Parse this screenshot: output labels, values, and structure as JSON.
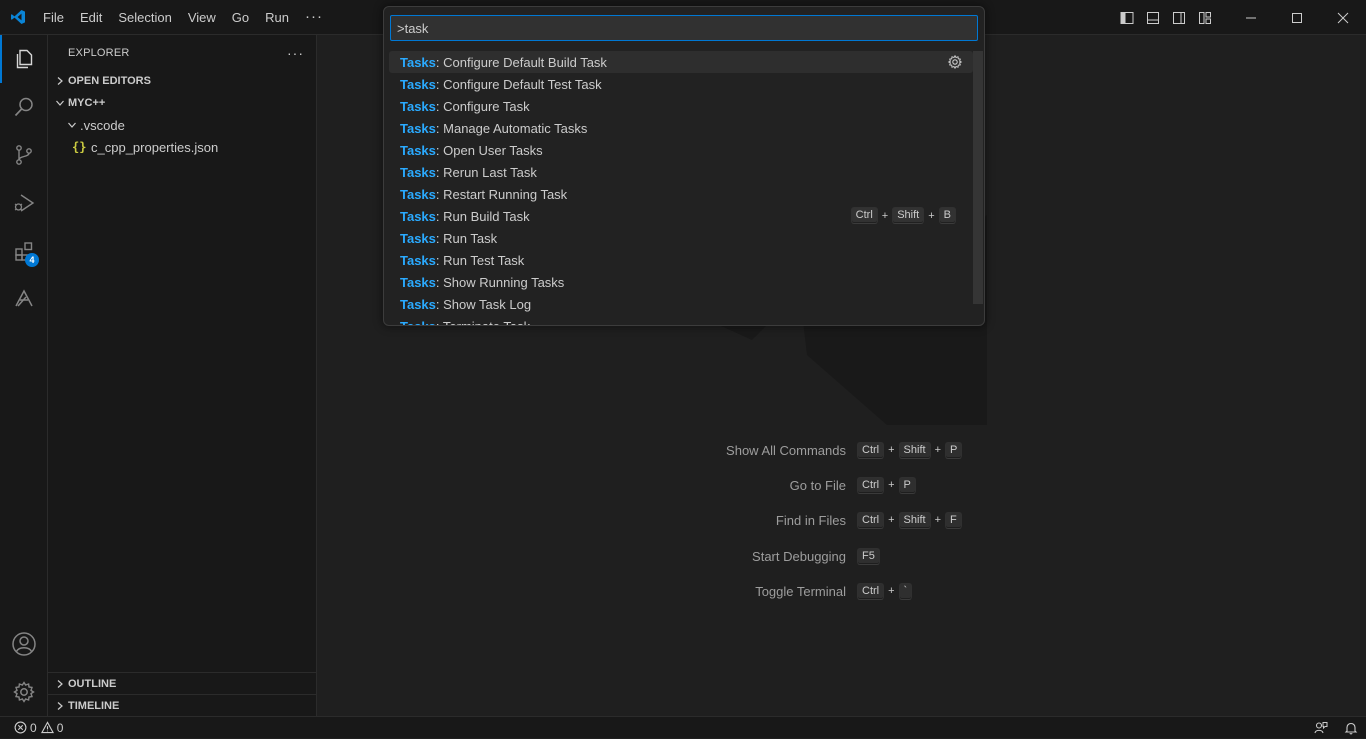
{
  "titlebar": {
    "logo_icon": "vscode-logo-icon",
    "menu": [
      "File",
      "Edit",
      "Selection",
      "View",
      "Go",
      "Run"
    ],
    "more": "···",
    "layout_icons": [
      "toggle-primary-sidebar-icon",
      "toggle-panel-icon",
      "toggle-secondary-sidebar-icon",
      "customize-layout-icon"
    ],
    "window_controls": [
      "minimize-icon",
      "maximize-icon",
      "close-icon"
    ]
  },
  "activitybar": {
    "items": [
      "explorer-icon",
      "search-icon",
      "source-control-icon",
      "run-debug-icon",
      "extensions-icon",
      "remote-explorer-icon"
    ],
    "extensions_badge": "4",
    "bottom": [
      "accounts-icon",
      "manage-gear-icon"
    ]
  },
  "sidebar": {
    "title": "EXPLORER",
    "dots": "···",
    "open_editors": "OPEN EDITORS",
    "workspace": "MYC++",
    "folder": ".vscode",
    "file_icon": "{}",
    "file": "c_cpp_properties.json",
    "outline": "OUTLINE",
    "timeline": "TIMELINE"
  },
  "palette": {
    "input_value": ">task",
    "highlight": "Tasks",
    "items": [
      {
        "rest": ": Configure Default Build Task",
        "selected": true
      },
      {
        "rest": ": Configure Default Test Task"
      },
      {
        "rest": ": Configure Task"
      },
      {
        "rest": ": Manage Automatic Tasks"
      },
      {
        "rest": ": Open User Tasks"
      },
      {
        "rest": ": Rerun Last Task"
      },
      {
        "rest": ": Restart Running Task"
      },
      {
        "rest": ": Run Build Task",
        "keys": [
          "Ctrl",
          "Shift",
          "B"
        ]
      },
      {
        "rest": ": Run Task"
      },
      {
        "rest": ": Run Test Task"
      },
      {
        "rest": ": Show Running Tasks"
      },
      {
        "rest": ": Show Task Log"
      },
      {
        "rest": ": Terminate Task"
      }
    ]
  },
  "shortcuts": [
    {
      "label": "Show All Commands",
      "keys": [
        "Ctrl",
        "Shift",
        "P"
      ]
    },
    {
      "label": "Go to File",
      "keys": [
        "Ctrl",
        "P"
      ]
    },
    {
      "label": "Find in Files",
      "keys": [
        "Ctrl",
        "Shift",
        "F"
      ]
    },
    {
      "label": "Start Debugging",
      "keys": [
        "F5"
      ]
    },
    {
      "label": "Toggle Terminal",
      "keys": [
        "Ctrl",
        "`"
      ]
    }
  ],
  "statusbar": {
    "errors": "0",
    "warnings": "0"
  },
  "colors": {
    "accent": "#0078d4",
    "highlight": "#2aaaff",
    "background": "#1f1f1f",
    "chrome": "#181818"
  }
}
